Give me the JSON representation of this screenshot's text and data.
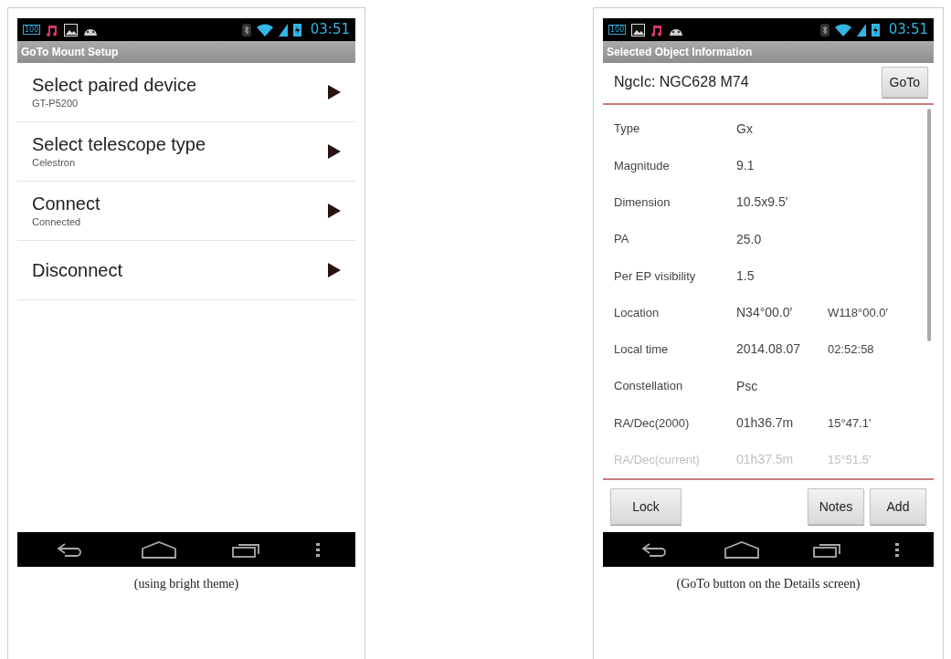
{
  "screens": [
    {
      "kind": "setup",
      "status_bar": {
        "battery_level_text": "100",
        "time": "03:51"
      },
      "title": "GoTo Mount Setup",
      "menu_items": [
        {
          "title": "Select paired device",
          "subtitle": "GT-P5200"
        },
        {
          "title": "Select telescope type",
          "subtitle": "Celestron"
        },
        {
          "title": "Connect",
          "subtitle": "Connected"
        },
        {
          "title": "Disconnect"
        }
      ],
      "caption": "(using bright theme)"
    },
    {
      "kind": "details",
      "status_bar": {
        "battery_level_text": "100",
        "time": "03:51"
      },
      "title": "Selected Object Information",
      "object_name": "NgcIc: NGC628 M74",
      "goto_button": "GoTo",
      "rows": [
        {
          "label": "Type",
          "values": [
            "Gx"
          ],
          "faded": false
        },
        {
          "label": "Magnitude",
          "values": [
            "9.1"
          ],
          "faded": false
        },
        {
          "label": "Dimension",
          "values": [
            "10.5x9.5′"
          ],
          "faded": false
        },
        {
          "label": "PA",
          "values": [
            "25.0"
          ],
          "faded": false
        },
        {
          "label": "Per EP visibility",
          "values": [
            "1.5"
          ],
          "faded": false
        },
        {
          "label": "Location",
          "values": [
            "N34°00.0′",
            "W118°00.0′"
          ],
          "faded": false
        },
        {
          "label": "Local time",
          "values": [
            "2014.08.07",
            "02:52:58"
          ],
          "faded": false
        },
        {
          "label": "Constellation",
          "values": [
            "Psc"
          ],
          "faded": false
        },
        {
          "label": "RA/Dec(2000)",
          "values": [
            "01h36.7m",
            "15°47.1'"
          ],
          "faded": false
        },
        {
          "label": "RA/Dec(current)",
          "values": [
            "01h37.5m",
            "15°51.5'"
          ],
          "faded": true
        }
      ],
      "buttons": [
        "Lock",
        "Notes",
        "Add"
      ],
      "caption": "(GoTo button on the Details screen)"
    }
  ]
}
